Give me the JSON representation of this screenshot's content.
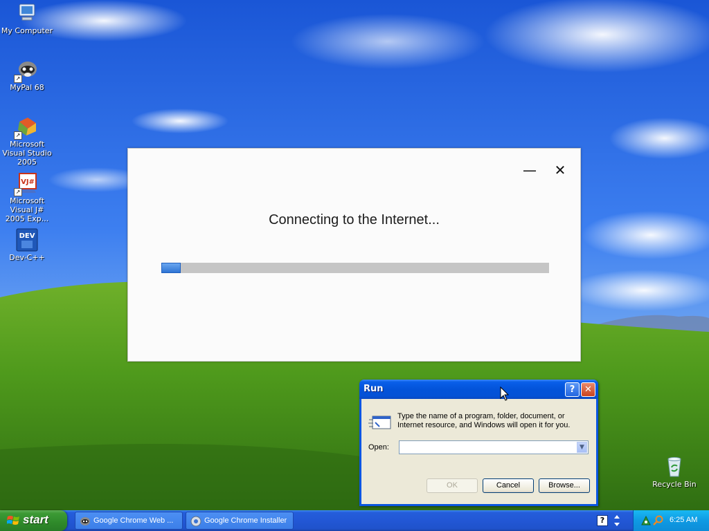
{
  "desktop": {
    "icons": [
      {
        "label": "My Computer"
      },
      {
        "label": "MyPal 68"
      },
      {
        "label": "Microsoft Visual Studio 2005"
      },
      {
        "label": "Microsoft Visual J# 2005 Exp..."
      },
      {
        "label": "Dev-C++"
      },
      {
        "label": "Recycle Bin"
      }
    ],
    "vj_badge": "VJ#",
    "dev_badge": "DEV"
  },
  "installer": {
    "status_text": "Connecting to the Internet...",
    "minimize_glyph": "—",
    "close_glyph": "✕",
    "progress": 0.05
  },
  "run_dialog": {
    "title": "Run",
    "help_glyph": "?",
    "close_glyph": "✕",
    "description": "Type the name of a program, folder, document, or Internet resource, and Windows will open it for you.",
    "open_label": "Open:",
    "open_value": "",
    "ok_label": "OK",
    "cancel_label": "Cancel",
    "browse_label": "Browse..."
  },
  "taskbar": {
    "start_label": "start",
    "tasks": [
      {
        "label": "Google Chrome Web ..."
      },
      {
        "label": "Google Chrome Installer"
      }
    ],
    "clock": "6:25 AM",
    "help_glyph": "?"
  }
}
